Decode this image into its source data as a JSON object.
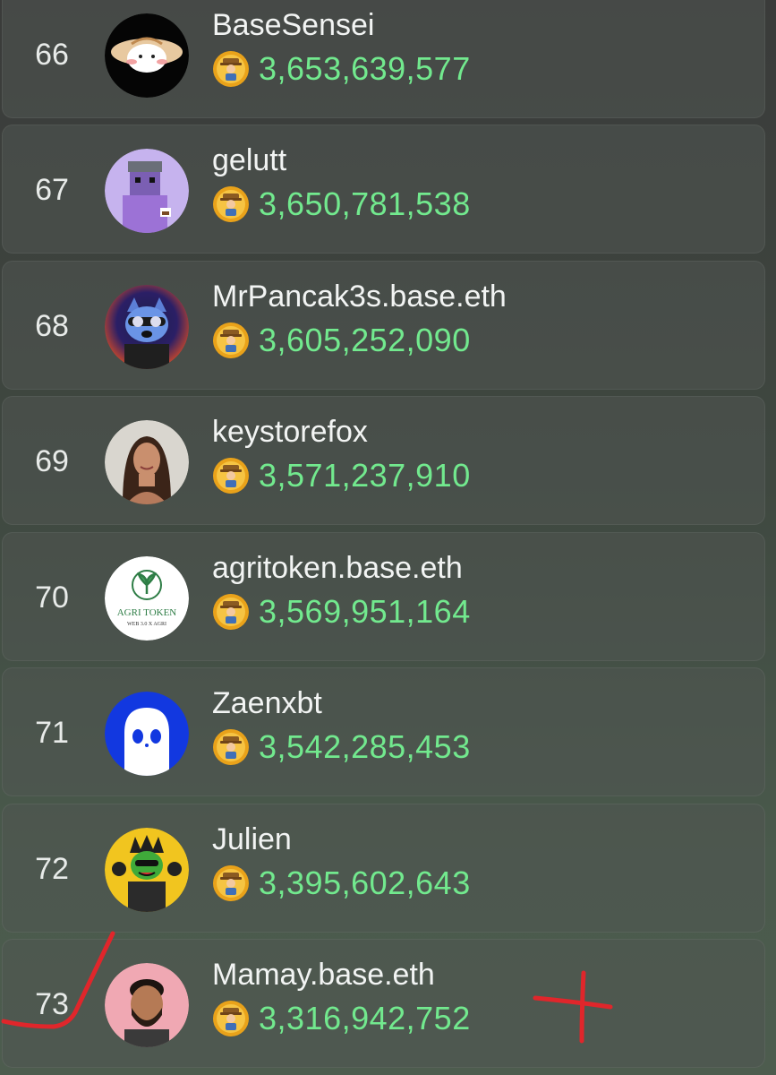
{
  "leaderboard": {
    "rows": [
      {
        "rank": "66",
        "name": "BaseSensei",
        "score": "3,653,639,577",
        "avatar": "rice-hat-character-avatar"
      },
      {
        "rank": "67",
        "name": "gelutt",
        "score": "3,650,781,538",
        "avatar": "purple-pixel-creature-avatar"
      },
      {
        "rank": "68",
        "name": "MrPancak3s.base.eth",
        "score": "3,605,252,090",
        "avatar": "raccoon-avatar"
      },
      {
        "rank": "69",
        "name": "keystorefox",
        "score": "3,571,237,910",
        "avatar": "woman-portrait-avatar"
      },
      {
        "rank": "70",
        "name": "agritoken.base.eth",
        "score": "3,569,951,164",
        "avatar": "agri-token-logo-avatar",
        "logo_title": "AGRI TOKEN",
        "logo_subtitle": "WEB 3.0 X AGRI"
      },
      {
        "rank": "71",
        "name": "Zaenxbt",
        "score": "3,542,285,453",
        "avatar": "white-ghost-avatar"
      },
      {
        "rank": "72",
        "name": "Julien",
        "score": "3,395,602,643",
        "avatar": "green-character-avatar"
      },
      {
        "rank": "73",
        "name": "Mamay.base.eth",
        "score": "3,316,942,752",
        "avatar": "man-portrait-avatar"
      }
    ]
  },
  "score_icon": "farmer-coin-icon",
  "colors": {
    "score": "#72e98e",
    "annotation": "#e0262b"
  },
  "annotations": [
    "red-checkmark",
    "red-cross"
  ]
}
